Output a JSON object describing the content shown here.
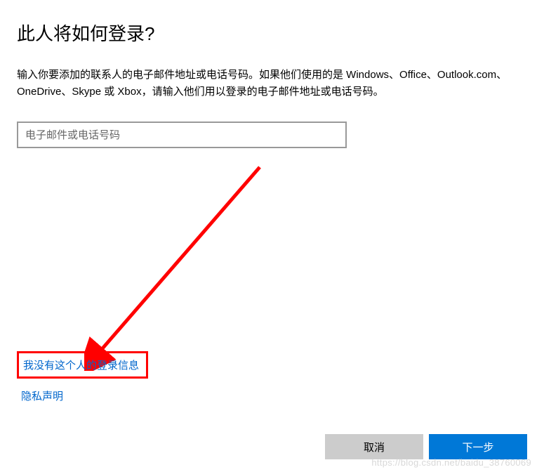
{
  "title": "此人将如何登录?",
  "description": "输入你要添加的联系人的电子邮件地址或电话号码。如果他们使用的是 Windows、Office、Outlook.com、OneDrive、Skype 或 Xbox，请输入他们用以登录的电子邮件地址或电话号码。",
  "input": {
    "placeholder": "电子邮件或电话号码",
    "value": ""
  },
  "links": {
    "no_signin_info": "我没有这个人的登录信息",
    "privacy": "隐私声明"
  },
  "buttons": {
    "cancel": "取消",
    "next": "下一步"
  },
  "watermark": "https://blog.csdn.net/baidu_38760069",
  "colors": {
    "highlight": "#ff0000",
    "primary": "#0078d7",
    "link": "#0066cc"
  }
}
